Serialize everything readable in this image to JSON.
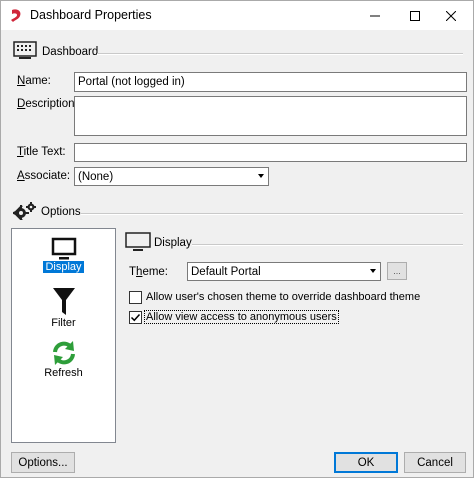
{
  "window": {
    "title": "Dashboard Properties",
    "accent_color": "#0078d7",
    "app_icon": "red-ribbon-icon"
  },
  "dashboard_section": {
    "title": "Dashboard",
    "icon": "keyboard-grid-icon",
    "name_label_underlined": "N",
    "name_label_rest": "ame:",
    "name_value": "Portal (not logged in)",
    "description_label_underlined": "D",
    "description_label_rest": "escription:",
    "description_value": "",
    "title_text_label_underlined": "T",
    "title_text_label_rest": "itle Text:",
    "title_text_value": "",
    "associate_label_underlined": "A",
    "associate_label_rest": "ssociate:",
    "associate_value": "(None)"
  },
  "options_section": {
    "title": "Options",
    "icon": "gears-icon",
    "nav": [
      {
        "label": "Display",
        "icon": "monitor-icon",
        "selected": true
      },
      {
        "label": "Filter",
        "icon": "funnel-icon",
        "selected": false
      },
      {
        "label": "Refresh",
        "icon": "refresh-icon",
        "selected": false
      }
    ]
  },
  "display_section": {
    "title": "Display",
    "theme_label_prefix": "T",
    "theme_label_underlined": "h",
    "theme_label_rest": "eme:",
    "theme_value": "Default Portal",
    "theme_browse_label": "...",
    "checkbox_override_label": "Allow user's chosen theme to override dashboard theme",
    "checkbox_override_checked": false,
    "checkbox_anonymous_label": "Allow view access to anonymous users",
    "checkbox_anonymous_checked": true
  },
  "buttons": {
    "options": "Options...",
    "ok": "OK",
    "cancel": "Cancel"
  }
}
